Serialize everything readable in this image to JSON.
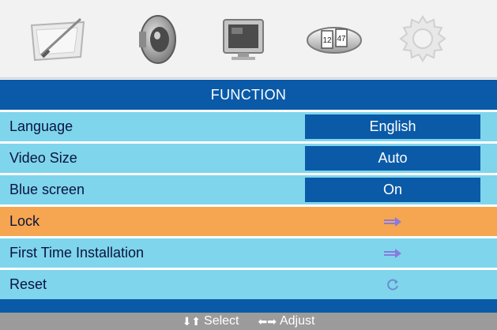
{
  "menu_tabs": [
    {
      "name": "picture",
      "icon": "picture-icon"
    },
    {
      "name": "sound",
      "icon": "speaker-icon"
    },
    {
      "name": "screen",
      "icon": "monitor-icon"
    },
    {
      "name": "time",
      "icon": "clock-icon",
      "clock_hour": "12",
      "clock_minute": "47"
    },
    {
      "name": "function",
      "icon": "gear-icon",
      "selected": true
    }
  ],
  "title": "FUNCTION",
  "rows": [
    {
      "label": "Language",
      "value": "English"
    },
    {
      "label": "Video Size",
      "value": "Auto"
    },
    {
      "label": "Blue screen",
      "value": "On"
    },
    {
      "label": "Lock",
      "control_icon": "arrow-right-icon",
      "highlighted": true
    },
    {
      "label": "First Time Installation",
      "control_icon": "arrow-right-icon"
    },
    {
      "label": "Reset",
      "control_icon": "refresh-icon"
    }
  ],
  "help": {
    "select": "Select",
    "adjust": "Adjust"
  },
  "colors": {
    "accent": "#0a5aa8",
    "row": "#7fd5ec",
    "highlight": "#f6a550",
    "helpbar": "#9b9b9b"
  }
}
